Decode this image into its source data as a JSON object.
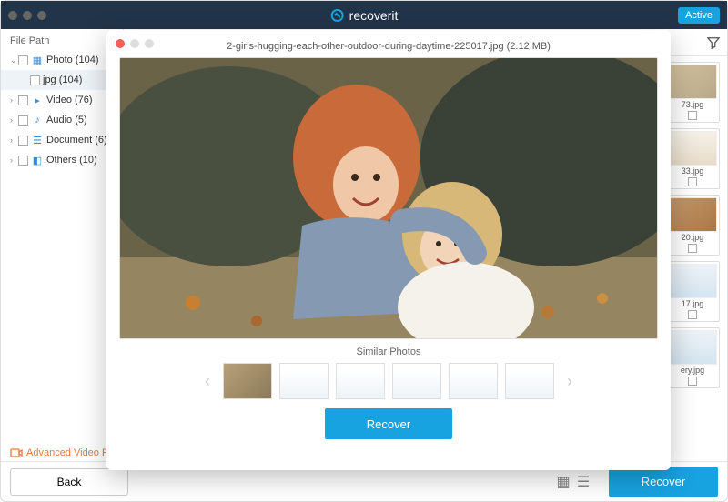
{
  "header": {
    "app_name": "recoverit",
    "active_btn": "Active"
  },
  "sidebar": {
    "heading": "File Path",
    "items": [
      {
        "label": "Photo (104)",
        "expanded": true
      },
      {
        "label": "jpg (104)",
        "child": true
      },
      {
        "label": "Video (76)"
      },
      {
        "label": "Audio (5)"
      },
      {
        "label": "Document (6)"
      },
      {
        "label": "Others (10)"
      }
    ]
  },
  "thumbs": [
    "73.jpg",
    "33.jpg",
    "20.jpg",
    "17.jpg",
    "ery.jpg"
  ],
  "advanced": "Advanced Video Rec",
  "back": "Back",
  "recover": "Recover",
  "modal": {
    "title": "2-girls-hugging-each-other-outdoor-during-daytime-225017.jpg (2.12 MB)",
    "similar": "Similar Photos",
    "recover": "Recover"
  }
}
